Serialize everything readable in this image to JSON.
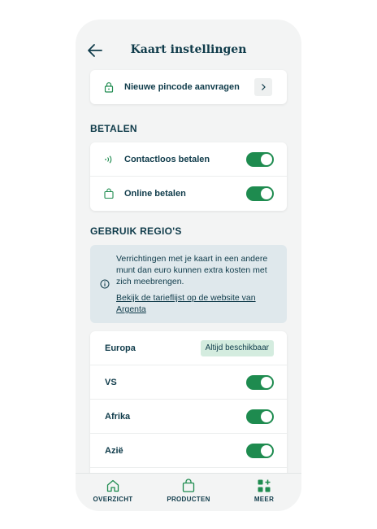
{
  "header": {
    "title": "Kaart instellingen"
  },
  "pincode": {
    "label": "Nieuwe pincode aanvragen",
    "icon": "lock-icon"
  },
  "betalen": {
    "heading": "BETALEN",
    "items": [
      {
        "label": "Contactloos betalen",
        "icon": "contactless-icon",
        "enabled": true
      },
      {
        "label": "Online betalen",
        "icon": "shopping-bag-icon",
        "enabled": true
      }
    ]
  },
  "regios": {
    "heading": "GEBRUIK REGIO'S",
    "info_text": "Verrichtingen met je kaart in een andere munt dan euro kunnen extra kosten met zich meebrengen.",
    "info_link": "Bekijk de tarieflijst op de website van Argenta",
    "items": [
      {
        "label": "Europa",
        "badge": "Altijd beschikbaar"
      },
      {
        "label": "VS",
        "enabled": true
      },
      {
        "label": "Afrika",
        "enabled": true
      },
      {
        "label": "Azië",
        "enabled": true
      }
    ]
  },
  "nav": {
    "items": [
      {
        "label": "OVERZICHT",
        "icon": "home-icon"
      },
      {
        "label": "PRODUCTEN",
        "icon": "shopping-bag-icon"
      },
      {
        "label": "MEER",
        "icon": "grid-plus-icon"
      }
    ]
  },
  "colors": {
    "accent": "#1e8b4f",
    "text": "#0f3b4a",
    "info_bg": "#dfe8ec",
    "badge_bg": "#d4ecdf"
  }
}
